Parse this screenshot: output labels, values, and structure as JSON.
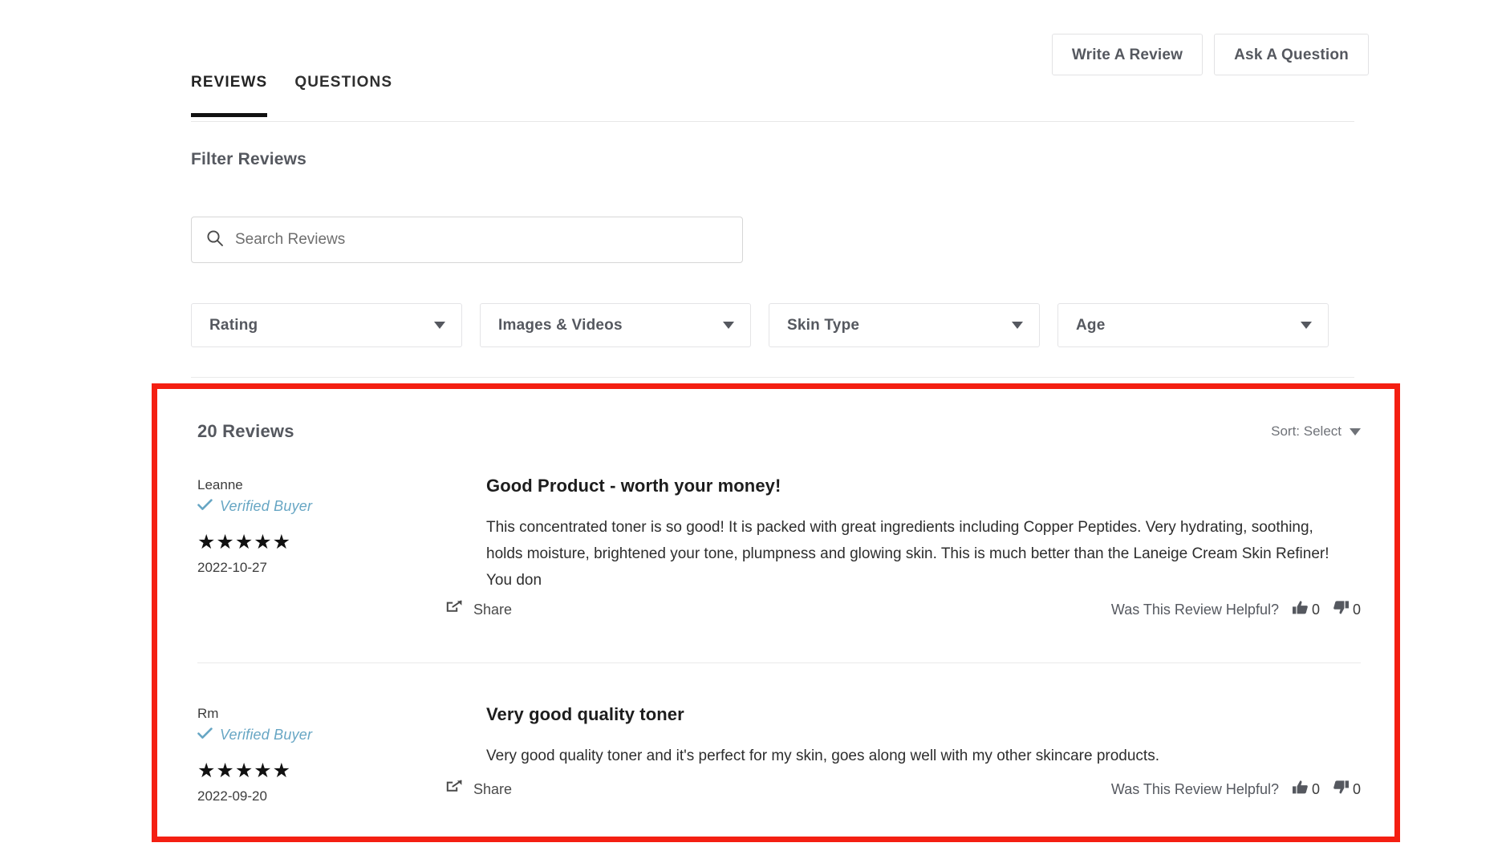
{
  "top_actions": {
    "write_review_label": "Write A Review",
    "ask_question_label": "Ask A Question"
  },
  "tabs": [
    {
      "label": "REVIEWS",
      "active": true
    },
    {
      "label": "QUESTIONS",
      "active": false
    }
  ],
  "filter": {
    "title": "Filter Reviews",
    "search_placeholder": "Search Reviews",
    "search_value": "",
    "search_icon": "search-icon",
    "dropdowns": [
      {
        "label": "Rating",
        "icon": "chevron-down-icon"
      },
      {
        "label": "Images & Videos",
        "icon": "chevron-down-icon"
      },
      {
        "label": "Skin Type",
        "icon": "chevron-down-icon"
      },
      {
        "label": "Age",
        "icon": "chevron-down-icon"
      }
    ]
  },
  "reviews_header": {
    "count_label": "20 Reviews",
    "sort_label": "Sort: Select",
    "sort_icon": "chevron-down-icon"
  },
  "common": {
    "verified_label": "Verified Buyer",
    "verified_icon": "check-icon",
    "share_label": "Share",
    "share_icon": "share-icon",
    "helpful_label": "Was This Review Helpful?",
    "thumbs_up_icon": "thumbs-up-icon",
    "thumbs_down_icon": "thumbs-down-icon"
  },
  "reviews": [
    {
      "author": "Leanne",
      "verified": "Verified Buyer",
      "stars": "★★★★★",
      "rating": 5,
      "date": "2022-10-27",
      "title": "Good Product - worth your money!",
      "text": "This concentrated toner is so good! It is packed with great ingredients including Copper Peptides. Very hydrating, soothing, holds moisture, brightened your tone, plumpness and glowing skin. This is much better than the Laneige Cream Skin Refiner! You don",
      "share": "Share",
      "helpful": "Was This Review Helpful?",
      "up_count": "0",
      "down_count": "0"
    },
    {
      "author": "Rm",
      "verified": "Verified Buyer",
      "stars": "★★★★★",
      "rating": 5,
      "date": "2022-09-20",
      "title": "Very good quality toner",
      "text": "Very good quality toner and it's perfect for my skin, goes along well with my other skincare products.",
      "share": "Share",
      "helpful": "Was This Review Helpful?",
      "up_count": "0",
      "down_count": "0"
    }
  ],
  "colors": {
    "highlight_border": "#f41f12",
    "verified_blue": "#67a6c4",
    "muted_text": "#55585f",
    "star_color": "#111111"
  }
}
